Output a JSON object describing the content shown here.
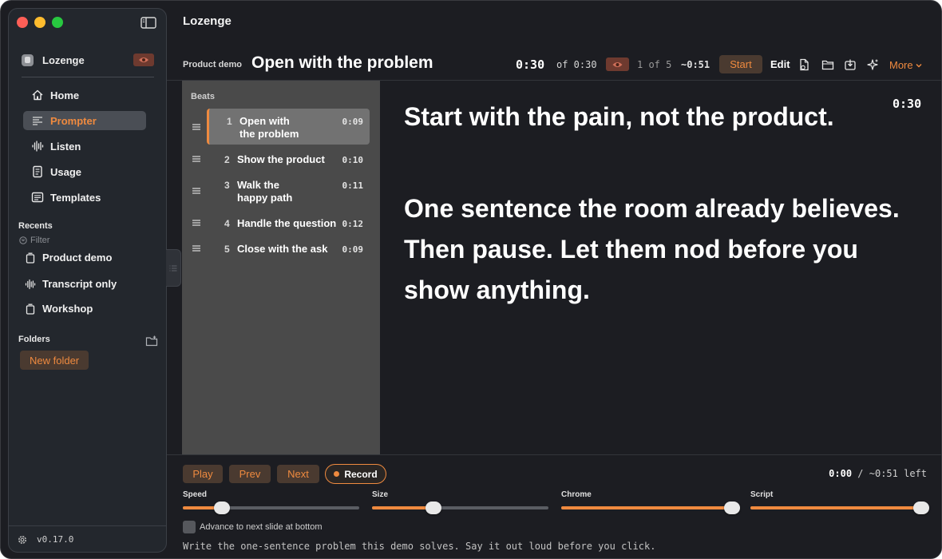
{
  "app": {
    "name": "Lozenge",
    "version": "v0.17.0"
  },
  "sidebar": {
    "nav": [
      {
        "label": "Home",
        "icon": "home-icon"
      },
      {
        "label": "Prompter",
        "icon": "prompter-icon",
        "active": true
      },
      {
        "label": "Listen",
        "icon": "waveform-icon"
      },
      {
        "label": "Usage",
        "icon": "document-icon"
      },
      {
        "label": "Templates",
        "icon": "templates-icon"
      }
    ],
    "recents_label": "Recents",
    "filter_label": "Filter",
    "recents": [
      {
        "label": "Product demo",
        "icon": "slides-icon"
      },
      {
        "label": "Transcript only",
        "icon": "waveform-icon"
      },
      {
        "label": "Workshop",
        "icon": "slides-icon"
      }
    ],
    "folders_label": "Folders",
    "new_folder_label": "New folder"
  },
  "toolbar": {
    "crumb": "Product demo",
    "title": "Open with the problem",
    "timer": "0:30",
    "timer_of": "of 0:30",
    "position": "1 of 5",
    "remaining": "~0:51",
    "start_label": "Start",
    "edit_label": "Edit",
    "more_label": "More"
  },
  "beats": {
    "label": "Beats",
    "items": [
      {
        "num": "1",
        "line1": "Open with",
        "line2": "the problem",
        "time": "0:09",
        "active": true
      },
      {
        "num": "2",
        "line1": "Show the product",
        "line2": "",
        "time": "0:10"
      },
      {
        "num": "3",
        "line1": "Walk the",
        "line2": "happy path",
        "time": "0:11"
      },
      {
        "num": "4",
        "line1": "Handle the question",
        "line2": "",
        "time": "0:12"
      },
      {
        "num": "5",
        "line1": "Close with the ask",
        "line2": "",
        "time": "0:09"
      }
    ]
  },
  "script": {
    "line1": "Start with the pain, not the product.",
    "line2": "One sentence the room already believes.",
    "line3": "Then pause. Let them nod before you",
    "line4": "show anything.",
    "corner_timer": "0:30"
  },
  "controls": {
    "play_label": "Play",
    "prev_label": "Prev",
    "next_label": "Next",
    "record_label": "Record",
    "elapsed": "0:00",
    "elapsed_sep": " / ",
    "elapsed_left": "~0:51 left",
    "sliders": [
      {
        "label": "Speed",
        "value": 0.22
      },
      {
        "label": "Size",
        "value": 0.35
      },
      {
        "label": "Chrome",
        "value": 0.97
      },
      {
        "label": "Script",
        "value": 0.97
      }
    ],
    "advance_label": "Advance to next slide at bottom",
    "advance_checked": false,
    "hint": "Write the one-sentence problem this demo solves. Say it out loud before you click."
  },
  "colors": {
    "accent": "#ef8a3f",
    "background": "#1c1d22",
    "sidebar": "#23272d",
    "beats_panel": "#4a4a4a"
  }
}
